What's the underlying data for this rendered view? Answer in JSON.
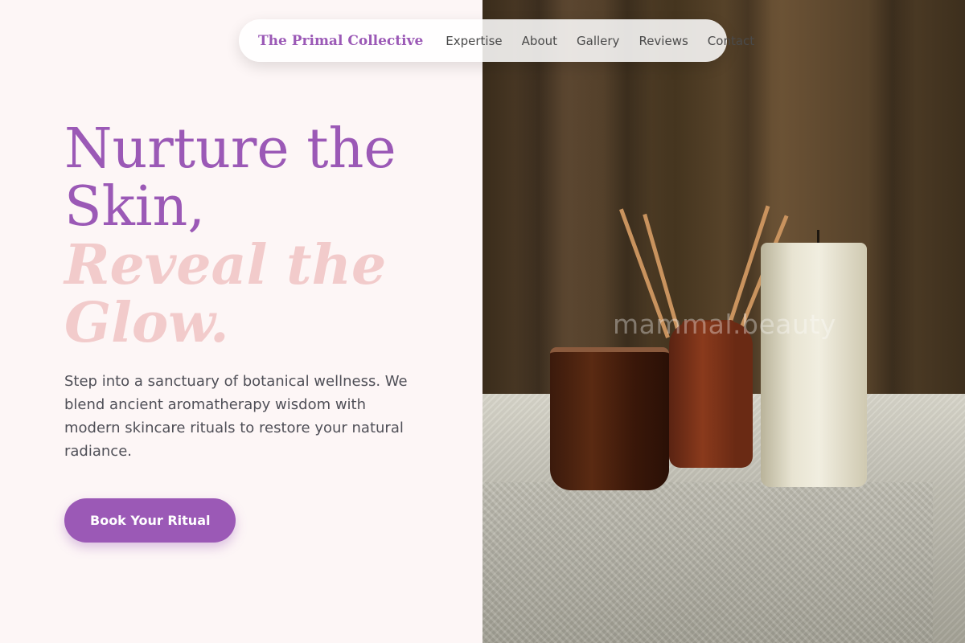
{
  "brand": {
    "name": "The Primal Collective",
    "color": "#9b59b6"
  },
  "nav": {
    "items": [
      {
        "label": "Expertise"
      },
      {
        "label": "About"
      },
      {
        "label": "Gallery"
      },
      {
        "label": "Reviews"
      },
      {
        "label": "Contact"
      }
    ]
  },
  "hero": {
    "headline_line1": "Nurture the",
    "headline_line2": "Skin,",
    "headline_italic_line1": "Reveal the",
    "headline_italic_line2": "Glow.",
    "description": "Step into a sanctuary of botanical wellness. We blend ancient aromatherapy wisdom with modern skincare rituals to restore your natural radiance.",
    "cta_label": "Book Your Ritual"
  },
  "image": {
    "watermark": "mammal.beauty",
    "subject": "amber glass, reed diffuser and pillar candle on a linen-covered table"
  },
  "colors": {
    "accent": "#9b59b6",
    "soft_pink": "#f2cbcb",
    "background": "#fdf6f6"
  }
}
